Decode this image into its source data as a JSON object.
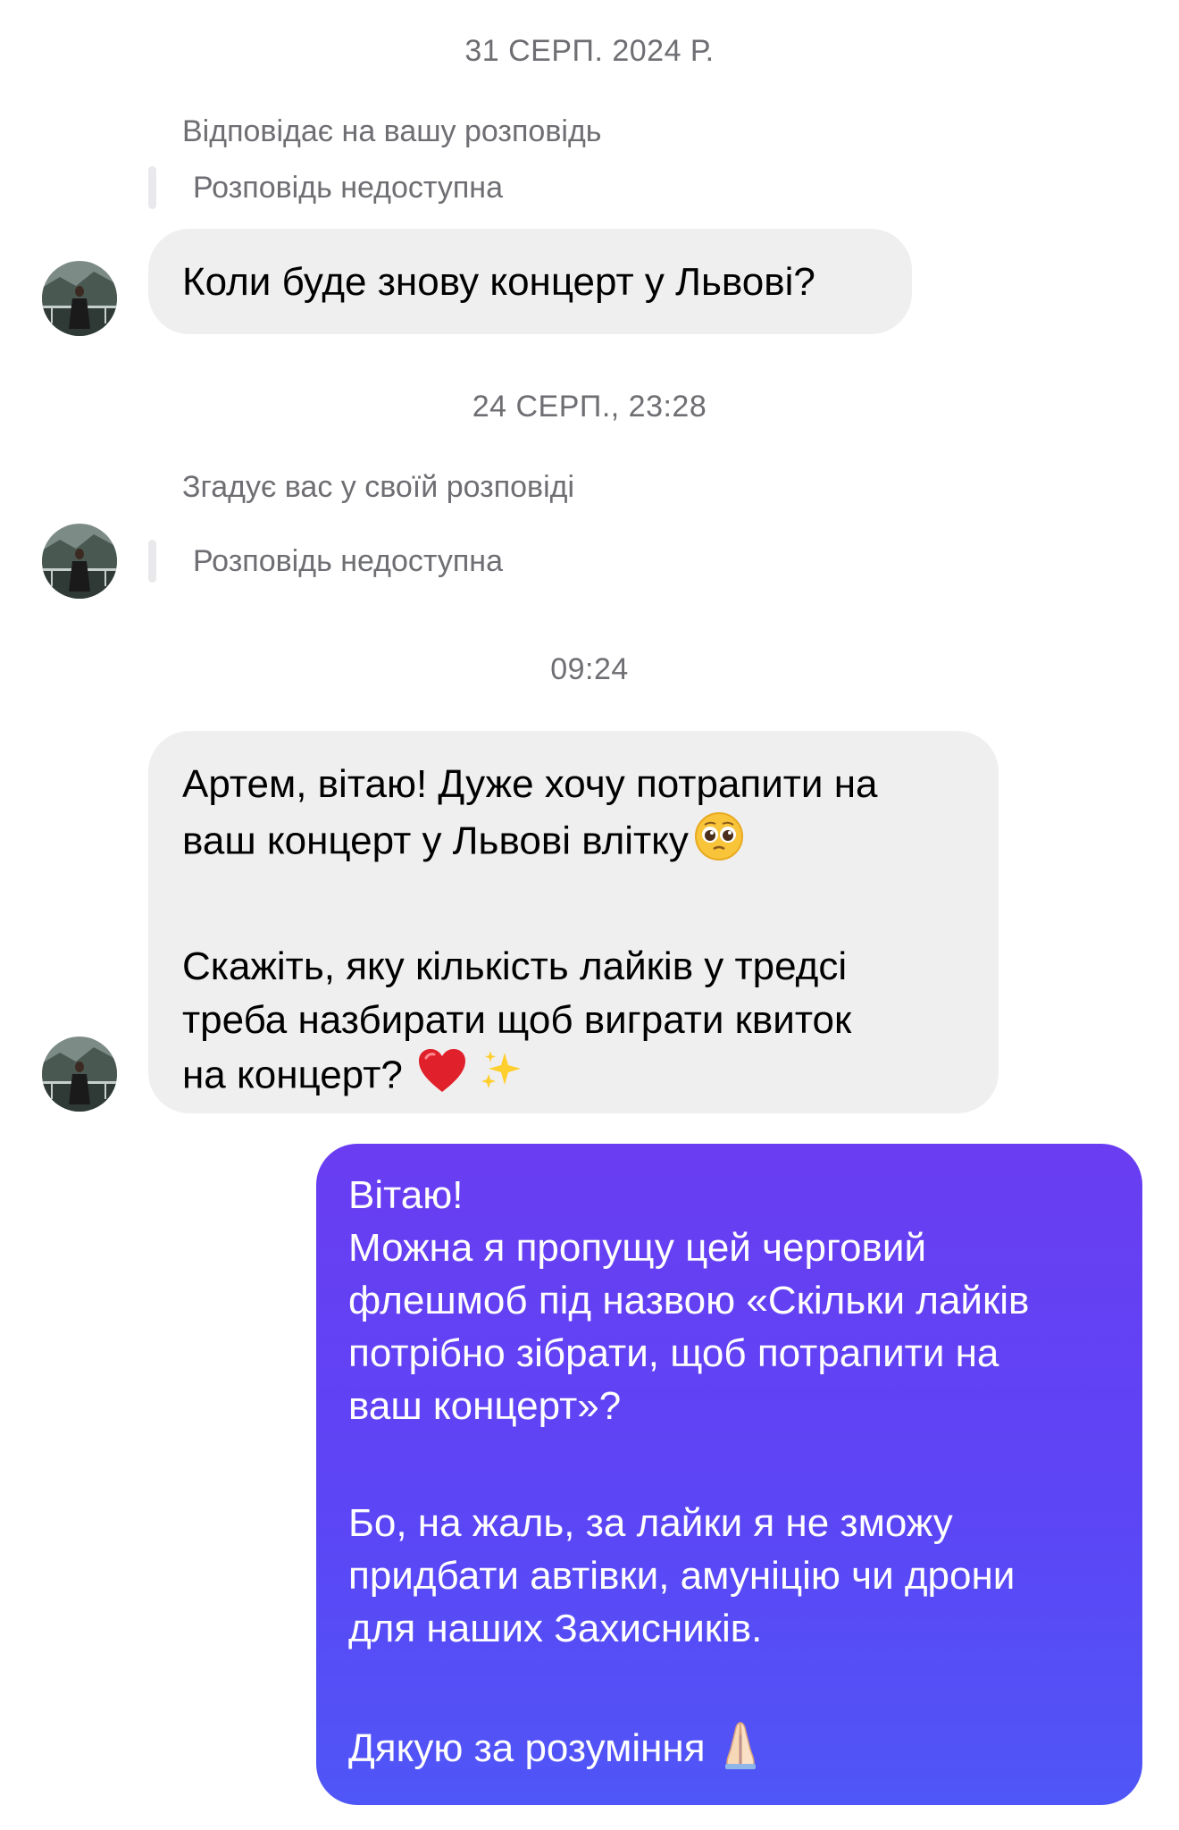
{
  "thread": {
    "timestamps": {
      "first": "31 СЕРП. 2024 Р.",
      "second": "24 СЕРП., 23:28",
      "third": "09:24"
    },
    "reply_caption_1": "Відповідає на вашу розповідь",
    "story_unavailable_1": "Розповідь недоступна",
    "message_1": "Коли буде знову концерт у Львові?",
    "reply_caption_2": "Згадує вас у своїй розповіді",
    "story_unavailable_2": "Розповідь недоступна",
    "message_3": {
      "line1": "Артем, вітаю! Дуже хочу потрапити на",
      "line2": "ваш концерт у Львові влітку",
      "line3": "Скажіть, яку кількість лайків у тредсі",
      "line4": "треба назбирати щоб виграти квиток",
      "line5": "на концерт?"
    },
    "reply": {
      "line1": "Вітаю!",
      "line2": "Можна я пропущу цей черговий",
      "line3": "флешмоб під назвою «Скільки лайків",
      "line4": "потрібно зібрати, щоб потрапити на",
      "line5": "ваш концерт»?",
      "line6": "Бо, на жаль, за лайки я не зможу",
      "line7": "придбати автівки, амуніцію чи дрони",
      "line8": "для наших Захисників.",
      "line9": "Дякую за розуміння"
    }
  },
  "colors": {
    "incoming_bubble": "#efefef",
    "outgoing_gradient_top": "#6a3df2",
    "outgoing_gradient_bottom": "#4f56f7",
    "meta_text": "#6e6e73"
  },
  "icons": [
    "avatar-photo",
    "pleading-face-emoji",
    "red-heart-emoji",
    "sparkles-emoji",
    "folded-hands-emoji"
  ]
}
